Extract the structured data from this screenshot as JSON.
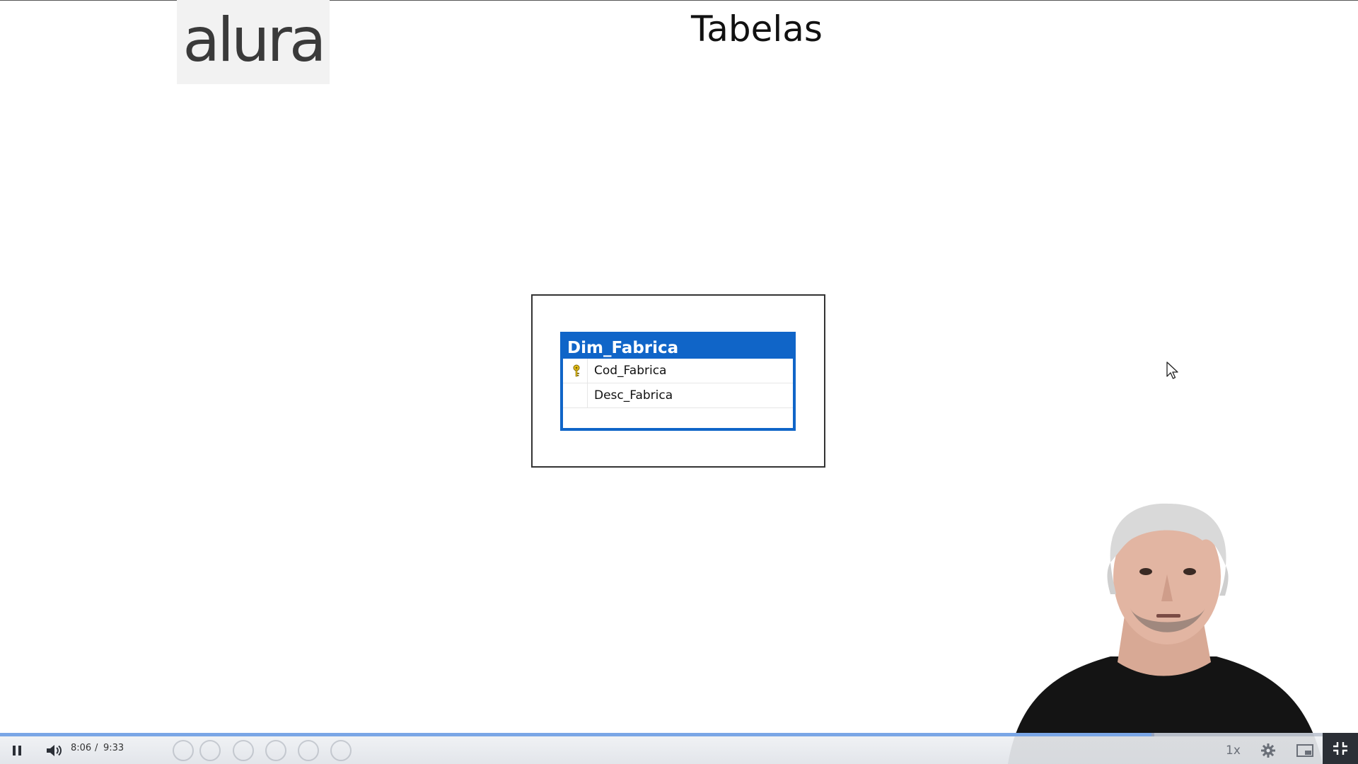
{
  "brand": {
    "logo_text": "alura"
  },
  "slide": {
    "title": "Tabelas"
  },
  "diagram": {
    "table_name": "Dim_Fabrica",
    "columns": [
      {
        "name": "Cod_Fabrica",
        "primary_key": true
      },
      {
        "name": "Desc_Fabrica",
        "primary_key": false
      }
    ],
    "header_color": "#1065c8"
  },
  "player": {
    "current_time": "8:06",
    "separator": "/",
    "duration": "9:33",
    "progress_fraction": 0.848,
    "buffer_fraction": 0.85,
    "speed_label": "1x",
    "accent_color": "#7aa6e6"
  }
}
